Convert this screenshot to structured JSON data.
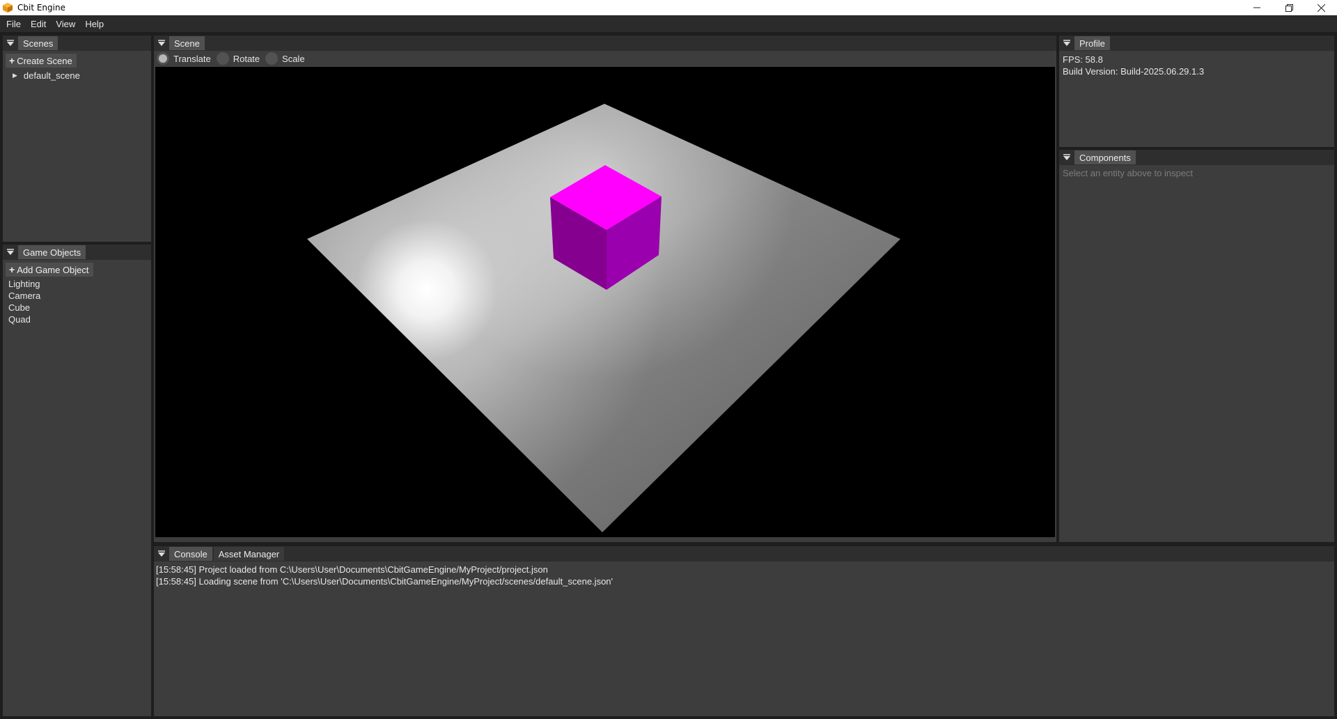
{
  "window": {
    "title": "Cbit Engine",
    "controls": [
      "minimize-icon",
      "restore-icon",
      "close-icon"
    ]
  },
  "menu": [
    "File",
    "Edit",
    "View",
    "Help"
  ],
  "scenes_panel": {
    "tab": "Scenes",
    "create_button": "Create Scene",
    "items": [
      "default_scene"
    ]
  },
  "objects_panel": {
    "tab": "Game Objects",
    "add_button": "Add Game Object",
    "items": [
      "Lighting",
      "Camera",
      "Cube",
      "Quad"
    ]
  },
  "scene_panel": {
    "tab": "Scene",
    "gizmo_modes": [
      {
        "label": "Translate",
        "selected": true
      },
      {
        "label": "Rotate",
        "selected": false
      },
      {
        "label": "Scale",
        "selected": false
      }
    ],
    "colors": {
      "cube": "#ff00ff",
      "background": "#000000",
      "plane": "#c8c8c8"
    }
  },
  "profile_panel": {
    "tab": "Profile",
    "fps": "FPS: 58.8",
    "build": "Build Version: Build-2025.06.29.1.3"
  },
  "components_panel": {
    "tab": "Components",
    "hint": "Select an entity above to inspect"
  },
  "bottom_panel": {
    "tabs": [
      "Console",
      "Asset Manager"
    ],
    "logs": [
      "[15:58:45] Project loaded from C:\\Users\\User\\Documents\\CbitGameEngine/MyProject/project.json",
      "[15:58:45] Loading scene from 'C:\\Users\\User\\Documents\\CbitGameEngine/MyProject/scenes/default_scene.json'"
    ]
  }
}
